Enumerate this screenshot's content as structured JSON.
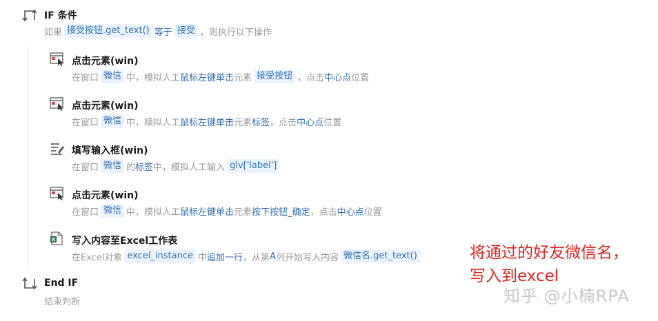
{
  "if_block": {
    "title": "IF 条件",
    "desc_prefix": "如果",
    "cond_var": "接受按钮.get_text()",
    "cond_op": "等于",
    "cond_value": "接受",
    "desc_suffix": "，则执行以下操作"
  },
  "steps": [
    {
      "title": "点击元素(win)",
      "d1": "在窗口",
      "window": "微信",
      "d2": "中，模拟人工",
      "action": "鼠标左键单击",
      "d3": "元素",
      "element": "接受按钮",
      "d4": "，点击",
      "pos": "中心点",
      "d5": "位置"
    },
    {
      "title": "点击元素(win)",
      "d1": "在窗口",
      "window": "微信",
      "d2": "中，模拟人工",
      "action": "鼠标左键单击",
      "d3": "元素",
      "element": "标签",
      "d4": "，点击",
      "pos": "中心点",
      "d5": "位置"
    },
    {
      "title": "填写输入框(win)",
      "d1": "在窗口",
      "window": "微信",
      "d2": "的",
      "field": "标签",
      "d3": "中，模拟人工输入",
      "value": "glv['label']"
    },
    {
      "title": "点击元素(win)",
      "d1": "在窗口",
      "window": "微信",
      "d2": "中，模拟人工",
      "action": "鼠标左键单击",
      "d3": "元素",
      "element": "按下按钮_确定",
      "d4": "，点击",
      "pos": "中心点",
      "d5": "位置"
    },
    {
      "title": "写入内容至Excel工作表",
      "d1": "在Excel对象",
      "obj": "excel_instance",
      "d2": "中",
      "action": "追加一行",
      "d3": "，从第",
      "col": "A",
      "d4": "列开始写入内容",
      "content": "微信名.get_text()"
    }
  ],
  "end_block": {
    "title": "End IF",
    "desc": "结束判断"
  },
  "annotation": {
    "line1": "将通过的好友微信名，",
    "line2": "写入到excel"
  },
  "watermark": "知乎 @小楠RPA",
  "colors": {
    "accent": "#2f6fb3",
    "pill_bg": "#ebf4fd",
    "annotation": "#e0231d",
    "muted": "#9a9a9a"
  },
  "icons": {
    "if": "if-branch-icon",
    "click": "click-element-icon",
    "input": "fill-input-icon",
    "excel": "excel-write-icon",
    "end": "end-if-icon"
  }
}
